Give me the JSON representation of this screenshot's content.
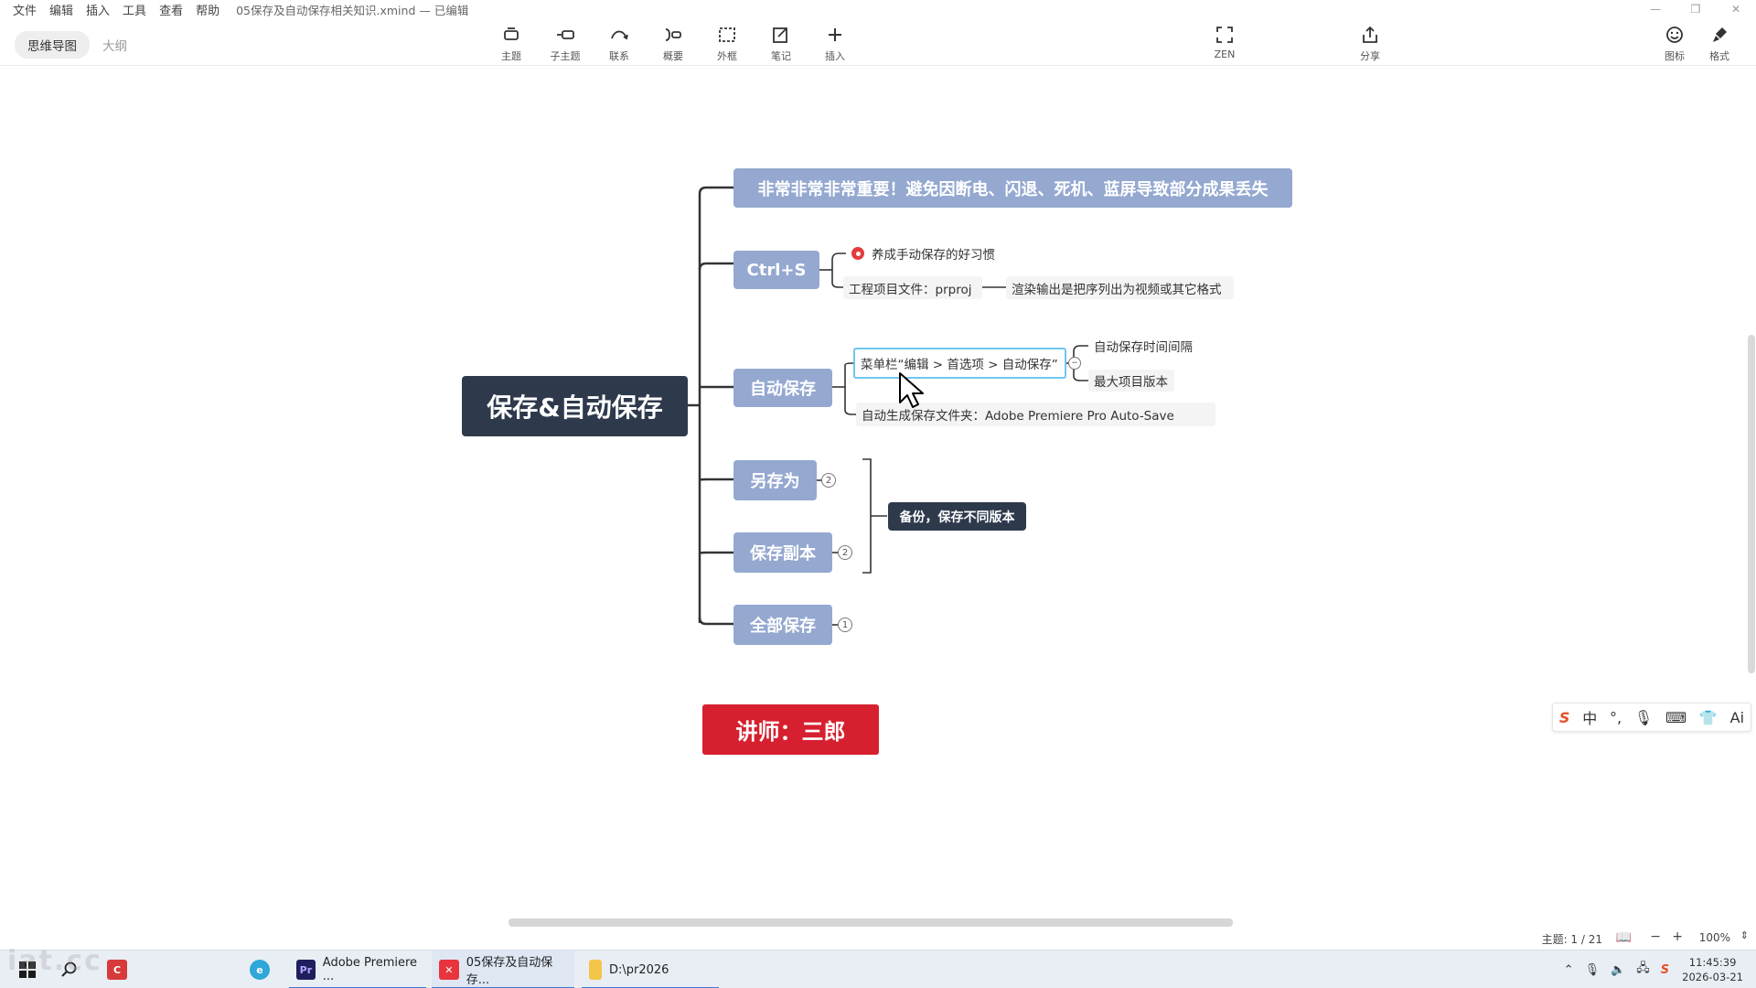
{
  "menubar": {
    "items": [
      "文件",
      "编辑",
      "插入",
      "工具",
      "查看",
      "帮助"
    ],
    "doc_title": "05保存及自动保存相关知识.xmind — 已编辑"
  },
  "toolbar": {
    "tabs": [
      "思维导图",
      "大纲"
    ],
    "tools": [
      "主题",
      "子主题",
      "联系",
      "概要",
      "外框",
      "笔记",
      "插入"
    ],
    "zen": "ZEN",
    "share": "分享",
    "icons": "图标",
    "format": "格式"
  },
  "mindmap": {
    "root": "保存&自动保存",
    "warning": "非常非常非常重要！避免因断电、闪退、死机、蓝屏导致部分成果丢失",
    "ctrl_s": {
      "title": "Ctrl+S",
      "habit": "养成手动保存的好习惯",
      "project_file": "工程项目文件：prproj",
      "render_note": "渲染输出是把序列出为视频或其它格式"
    },
    "autosave": {
      "title": "自动保存",
      "menu_path": "菜单栏“编辑 > 首选项 > 自动保存”",
      "interval": "自动保存时间间隔",
      "max_versions": "最大项目版本",
      "folder": "自动生成保存文件夹：Adobe Premiere Pro Auto-Save"
    },
    "save_as": {
      "title": "另存为",
      "count": "2"
    },
    "save_copy": {
      "title": "保存副本",
      "count": "2"
    },
    "save_all": {
      "title": "全部保存",
      "count": "1"
    },
    "summary": "备份，保存不同版本",
    "teacher": "讲师：三郎"
  },
  "statusbar": {
    "topic_count": "主题: 1 / 21",
    "zoom": "100%"
  },
  "ime": [
    "S",
    "中",
    "°,",
    "🎙",
    "⌨",
    "👕",
    "Ai"
  ],
  "taskbar": {
    "premiere": "Adobe Premiere ...",
    "xmind": "05保存及自动保存...",
    "folder": "D:\\pr2026",
    "time": "11:45:39",
    "date": "2026-03-21"
  },
  "watermark": "iat.cc",
  "colors": {
    "root": "#2e3a4c",
    "main_topic": "#94a8d0",
    "teacher": "#d6202f",
    "selection": "#6ec6f0"
  }
}
